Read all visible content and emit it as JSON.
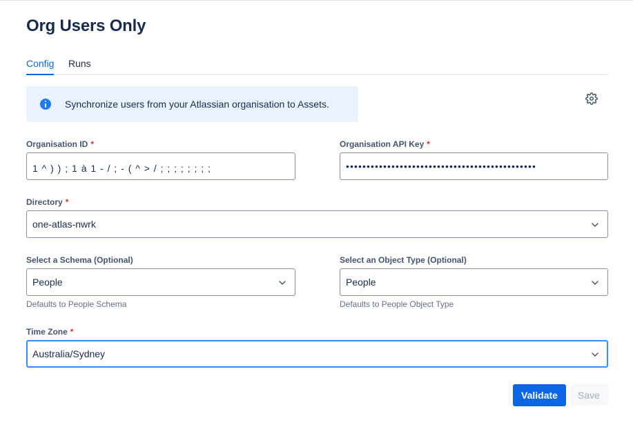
{
  "page": {
    "title": "Org Users Only"
  },
  "tabs": [
    {
      "label": "Config",
      "active": true
    },
    {
      "label": "Runs",
      "active": false
    }
  ],
  "banner": {
    "text": "Synchronize users from your Atlassian organisation to Assets.",
    "icon": "info-icon"
  },
  "settings": {
    "icon": "gear-icon"
  },
  "form": {
    "org_id": {
      "label": "Organisation ID",
      "required_mark": "*",
      "value": "1 ^ ) ) ; 1 à 1 - / ; - ( ^ > / ; ; ; ; ; ; ; ;"
    },
    "api_key": {
      "label": "Organisation API Key",
      "required_mark": "*",
      "value": "••••••••••••••••••••••••••••••••••••••••••••••"
    },
    "directory": {
      "label": "Directory",
      "required_mark": "*",
      "value": "one-atlas-nwrk"
    },
    "schema": {
      "label": "Select a Schema (Optional)",
      "value": "People",
      "helper": "Defaults to People Schema"
    },
    "object_type": {
      "label": "Select an Object Type (Optional)",
      "value": "People",
      "helper": "Defaults to People Object Type"
    },
    "timezone": {
      "label": "Time Zone",
      "required_mark": "*",
      "value": "Australia/Sydney"
    }
  },
  "actions": {
    "validate": "Validate",
    "save": "Save"
  },
  "colors": {
    "accent": "#0c66e4",
    "banner_bg": "#e9f2ff",
    "required": "#c9372c",
    "focus": "#388bff"
  }
}
